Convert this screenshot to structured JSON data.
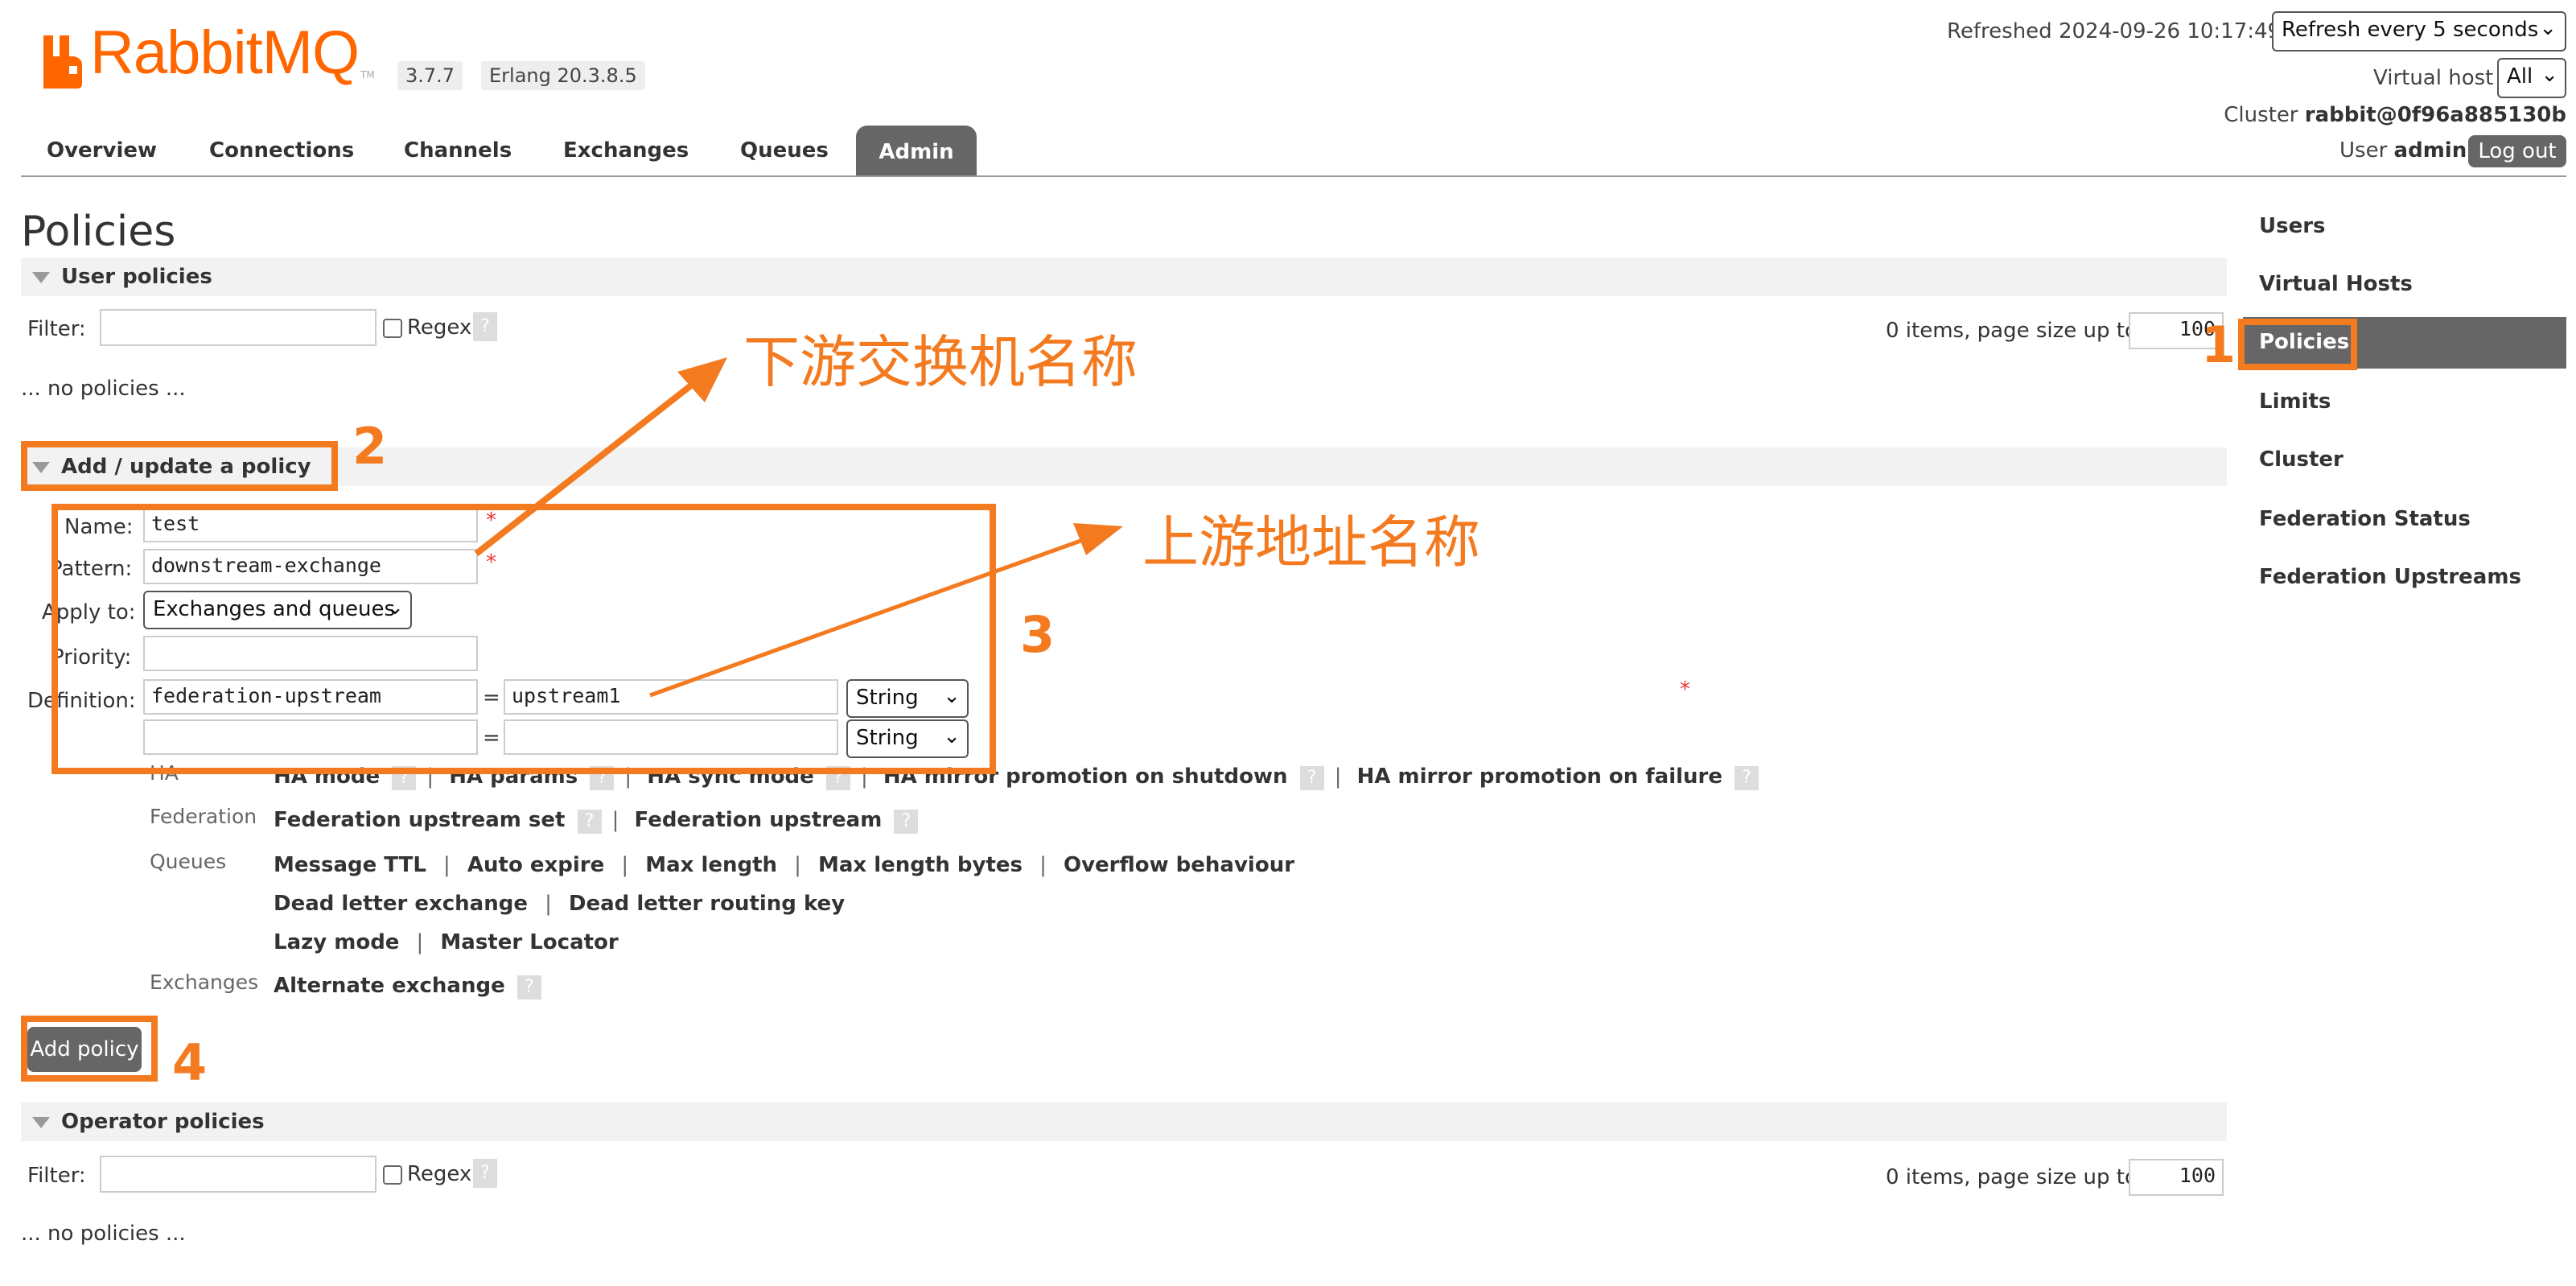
{
  "header": {
    "logo_text": "RabbitMQ",
    "logo_tm": "TM",
    "version": "3.7.7",
    "erlang": "Erlang 20.3.8.5",
    "refreshed_label": "Refreshed 2024-09-26 10:17:49",
    "refresh_select": "Refresh every 5 seconds",
    "vhost_label": "Virtual host",
    "vhost_select": "All",
    "cluster_label": "Cluster",
    "cluster_name": "rabbit@0f96a885130b",
    "user_label": "User",
    "user_name": "admin",
    "logout_label": "Log out"
  },
  "tabs": [
    "Overview",
    "Connections",
    "Channels",
    "Exchanges",
    "Queues",
    "Admin"
  ],
  "active_tab": "Admin",
  "sidebar": {
    "items": [
      "Users",
      "Virtual Hosts",
      "Policies",
      "Limits",
      "Cluster",
      "Federation Status",
      "Federation Upstreams"
    ],
    "active": "Policies"
  },
  "page": {
    "title": "Policies",
    "user_policies": {
      "title": "User policies",
      "filter_label": "Filter:",
      "filter_value": "",
      "regex_label": "Regex",
      "help": "?",
      "page_info": "0 items, page size up to",
      "page_size": "100",
      "empty": "... no policies ..."
    },
    "add_policy": {
      "title": "Add / update a policy",
      "name_label": "Name:",
      "name_value": "test",
      "pattern_label": "Pattern:",
      "pattern_value": "downstream-exchange",
      "apply_label": "Apply to:",
      "apply_value": "Exchanges and queues",
      "priority_label": "Priority:",
      "priority_value": "",
      "definition_label": "Definition:",
      "def_rows": [
        {
          "key": "federation-upstream",
          "value": "upstream1",
          "type": "String"
        },
        {
          "key": "",
          "value": "",
          "type": "String"
        }
      ],
      "equals": "=",
      "required": "*",
      "categories": {
        "ha": {
          "label": "HA",
          "links": [
            "HA mode",
            "HA params",
            "HA sync mode",
            "HA mirror promotion on shutdown",
            "HA mirror promotion on failure"
          ]
        },
        "federation": {
          "label": "Federation",
          "links": [
            "Federation upstream set",
            "Federation upstream"
          ]
        },
        "queues": {
          "label": "Queues",
          "row1": [
            "Message TTL",
            "Auto expire",
            "Max length",
            "Max length bytes",
            "Overflow behaviour"
          ],
          "row2": [
            "Dead letter exchange",
            "Dead letter routing key"
          ],
          "row3": [
            "Lazy mode",
            "Master Locator"
          ]
        },
        "exchanges": {
          "label": "Exchanges",
          "links": [
            "Alternate exchange"
          ]
        }
      },
      "separator": "|",
      "submit_label": "Add policy"
    },
    "operator_policies": {
      "title": "Operator policies",
      "filter_label": "Filter:",
      "filter_value": "",
      "regex_label": "Regex",
      "help": "?",
      "page_info": "0 items, page size up to",
      "page_size": "100",
      "empty": "... no policies ..."
    }
  },
  "annotations": {
    "nums": [
      "1",
      "2",
      "3",
      "4"
    ],
    "downstream_note": "下游交换机名称",
    "upstream_note": "上游地址名称",
    "color": "#f47a20"
  }
}
